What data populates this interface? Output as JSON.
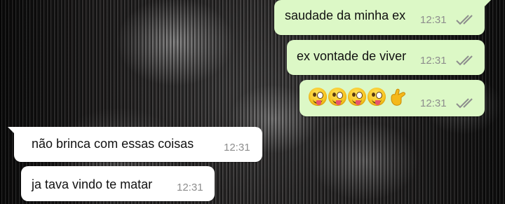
{
  "chat": {
    "messages": [
      {
        "direction": "outgoing",
        "text": "saudade da minha ex",
        "time": "12:31",
        "status": "read"
      },
      {
        "direction": "outgoing",
        "text": "ex vontade de viver",
        "time": "12:31",
        "status": "read"
      },
      {
        "direction": "outgoing",
        "text": "😜😜😜😜🤙",
        "time": "12:31",
        "status": "read",
        "emoji_icons": [
          "winking-face-with-tongue-icon",
          "winking-face-with-tongue-icon",
          "winking-face-with-tongue-icon",
          "winking-face-with-tongue-icon",
          "call-me-hand-icon"
        ]
      },
      {
        "direction": "incoming",
        "text": "não brinca com essas coisas",
        "time": "12:31"
      },
      {
        "direction": "incoming",
        "text": "ja tava vindo te matar",
        "time": "12:31"
      }
    ]
  },
  "colors": {
    "outgoing_bubble": "#dcf8c6",
    "incoming_bubble": "#ffffff",
    "timestamp": "#8d8d8d",
    "read_ticks": "#8d8d8d"
  }
}
